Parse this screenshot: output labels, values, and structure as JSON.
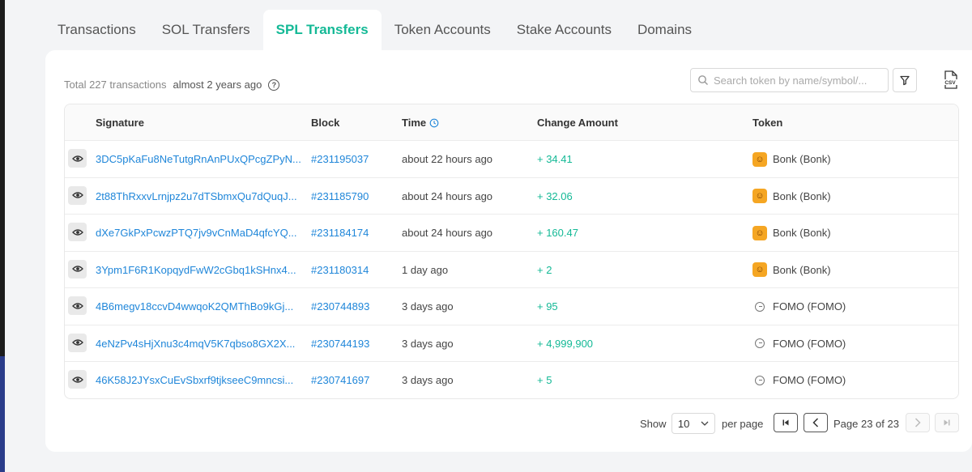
{
  "tabs": [
    {
      "label": "Transactions"
    },
    {
      "label": "SOL Transfers"
    },
    {
      "label": "SPL Transfers"
    },
    {
      "label": "Token Accounts"
    },
    {
      "label": "Stake Accounts"
    },
    {
      "label": "Domains"
    }
  ],
  "active_tab": "SPL Transfers",
  "summary": {
    "total": "Total 227 transactions",
    "ago": "almost 2 years ago"
  },
  "search": {
    "placeholder": "Search token by name/symbol/..."
  },
  "table": {
    "headers": {
      "signature": "Signature",
      "block": "Block",
      "time": "Time",
      "change": "Change Amount",
      "token": "Token"
    },
    "rows": [
      {
        "signature": "3DC5pKaFu8NeTutgRnAnPUxQPcgZPyN...",
        "block": "#231195037",
        "time": "about 22 hours ago",
        "change": "+ 34.41",
        "token": "Bonk (Bonk)",
        "icon": "bonk-icon"
      },
      {
        "signature": "2t88ThRxxvLrnjpz2u7dTSbmxQu7dQuqJ...",
        "block": "#231185790",
        "time": "about 24 hours ago",
        "change": "+ 32.06",
        "token": "Bonk (Bonk)",
        "icon": "bonk-icon"
      },
      {
        "signature": "dXe7GkPxPcwzPTQ7jv9vCnMaD4qfcYQ...",
        "block": "#231184174",
        "time": "about 24 hours ago",
        "change": "+ 160.47",
        "token": "Bonk (Bonk)",
        "icon": "bonk-icon"
      },
      {
        "signature": "3Ypm1F6R1KopqydFwW2cGbq1kSHnx4...",
        "block": "#231180314",
        "time": "1 day ago",
        "change": "+ 2",
        "token": "Bonk (Bonk)",
        "icon": "bonk-icon"
      },
      {
        "signature": "4B6megv18ccvD4wwqoK2QMThBo9kGj...",
        "block": "#230744893",
        "time": "3 days ago",
        "change": "+ 95",
        "token": "FOMO (FOMO)",
        "icon": "fomo-icon"
      },
      {
        "signature": "4eNzPv4sHjXnu3c4mqV5K7qbso8GX2X...",
        "block": "#230744193",
        "time": "3 days ago",
        "change": "+ 4,999,900",
        "token": "FOMO (FOMO)",
        "icon": "fomo-icon"
      },
      {
        "signature": "46K58J2JYsxCuEvSbxrf9tjkseeC9mncsi...",
        "block": "#230741697",
        "time": "3 days ago",
        "change": "+ 5",
        "token": "FOMO (FOMO)",
        "icon": "fomo-icon"
      }
    ]
  },
  "pagination": {
    "show": "Show",
    "page_size": "10",
    "per_page": "per page",
    "page_info": "Page 23 of 23"
  },
  "colors": {
    "accent": "#14b996",
    "link": "#1f86d9"
  }
}
